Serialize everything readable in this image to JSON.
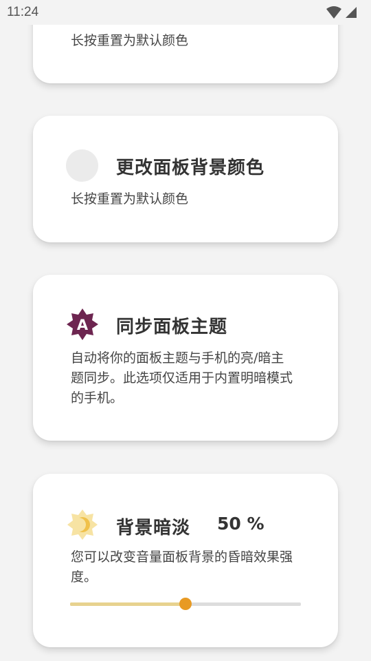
{
  "status_bar": {
    "time": "11:24"
  },
  "cards": {
    "partial": {
      "description": "长按重置为默认颜色"
    },
    "background_color": {
      "title": "更改面板背景颜色",
      "description": "长按重置为默认颜色",
      "swatch_color": "#ebebeb"
    },
    "sync_theme": {
      "title": "同步面板主题",
      "description": "自动将你的面板主题与手机的亮/暗主题同步。此选项仅适用于内置明暗模式的手机。",
      "icon": "auto-theme-icon",
      "icon_letter": "A",
      "icon_color": "#6d2550"
    },
    "background_dim": {
      "title": "背景暗淡",
      "percent": "50 %",
      "description": "您可以改变音量面板背景的昏暗效果强度。",
      "icon": "brightness-icon",
      "slider_value": 0.5,
      "slider_fill_color": "#e7d28f",
      "slider_thumb_color": "#e89a23"
    }
  }
}
